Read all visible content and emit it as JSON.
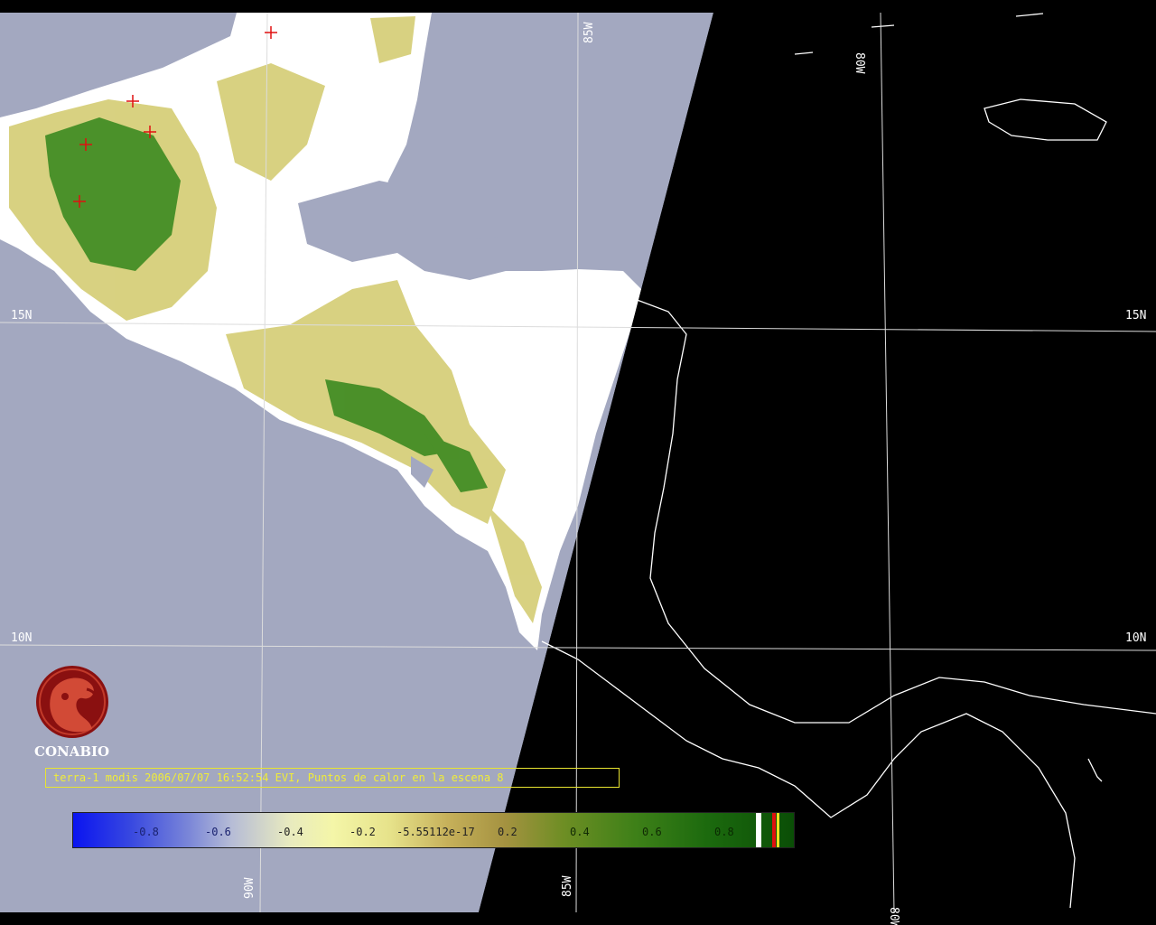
{
  "grid_labels": {
    "lon_85w_top": "85W",
    "lon_80w_top": "80W",
    "lat_15n_left": "15N",
    "lat_15n_right": "15N",
    "lat_10n_left": "10N",
    "lat_10n_right": "10N",
    "lon_90w_bottom": "90W",
    "lon_85w_bottom": "85W",
    "lon_80w_bottom": "80W"
  },
  "logo": {
    "text": "CONABIO",
    "icon": "conabio-macaw-logo"
  },
  "caption": "terra-1 modis 2006/07/07 16:52:54 EVI, Puntos de calor en la escena 8",
  "colorbar": {
    "ticks": [
      "-0.8",
      "-0.6",
      "-0.4",
      "-0.2",
      "-5.55112e-17",
      "0.2",
      "0.4",
      "0.6",
      "0.8"
    ],
    "colors": {
      "low": "#0a14f0",
      "mid": "#f4f6a8",
      "high": "#0a4e06",
      "cloud": "#ffffff",
      "fire": "#e01010"
    }
  },
  "map_colors": {
    "ocean_swath": "#a3a8c0",
    "land_cloud": "#ffffff",
    "vegetation_yellow": "#d6cf7a",
    "vegetation_green": "#3c8a20",
    "night": "#000000",
    "coastline": "#ffffff",
    "fire_marker": "#e01010"
  }
}
